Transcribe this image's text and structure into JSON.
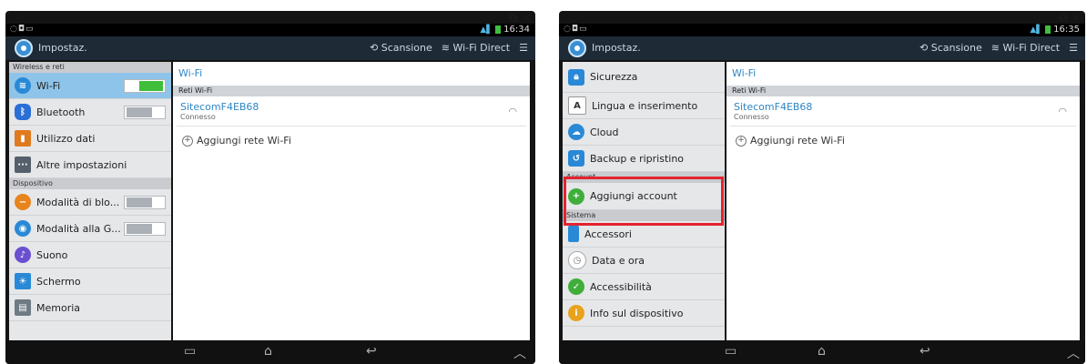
{
  "statusbar": {
    "left_icons": "◌◘▭",
    "time_a": "16:34",
    "time_b": "16:35",
    "window_icons": "⧉ ✕"
  },
  "actionbar": {
    "title": "Impostaz.",
    "scan_label": "Scansione",
    "wifi_direct_label": "Wi-Fi Direct",
    "menu_icon": "☰"
  },
  "screen_a": {
    "sections": {
      "wireless": "Wireless e reti",
      "device": "Dispositivo"
    },
    "items": {
      "wifi": "Wi-Fi",
      "bluetooth": "Bluetooth",
      "data": "Utilizzo dati",
      "more": "Altre impostazioni",
      "block": "Modalità di blo...",
      "glove": "Modalità alla G...",
      "sound": "Suono",
      "screen": "Schermo",
      "memory": "Memoria"
    }
  },
  "screen_b": {
    "sections": {
      "account": "Account",
      "system": "Sistema"
    },
    "items": {
      "security": "Sicurezza",
      "language": "Lingua e inserimento",
      "cloud": "Cloud",
      "backup": "Backup e ripristino",
      "add_account": "Aggiungi account",
      "accessories": "Accessori",
      "datetime": "Data e ora",
      "accessibility": "Accessibilità",
      "device_info": "Info sul dispositivo"
    }
  },
  "wifi_panel": {
    "title": "Wi-Fi",
    "section": "Reti Wi-Fi",
    "network_name": "SitecomF4EB68",
    "network_status": "Connesso",
    "add_network": "Aggiungi rete Wi-Fi"
  },
  "toggles": {
    "wifi": true,
    "bluetooth": false,
    "block": false,
    "glove": false
  },
  "colors": {
    "selected_item": "#8fc4ea",
    "accent_blue": "#2f86c4",
    "highlight_red": "#e3232f",
    "toggle_on": "#3fbe3a"
  }
}
